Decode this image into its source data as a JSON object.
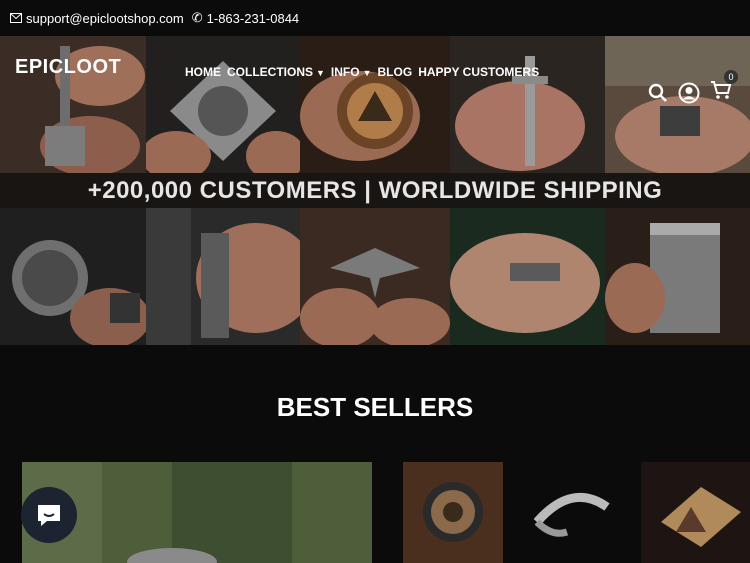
{
  "topbar": {
    "email": "support@epiclootshop.com",
    "phone": "1-863-231-0844"
  },
  "header": {
    "logo": "EPICLOOT",
    "menu": {
      "home": "HOME",
      "collections": "COLLECTIONS",
      "info": "INFO",
      "blog": "BLOG",
      "happy_customers": "HAPPY CUSTOMERS"
    },
    "cart_count": "0"
  },
  "hero": {
    "banner_text": "+200,000 CUSTOMERS | WORLDWIDE SHIPPING"
  },
  "section": {
    "title": "BEST SELLERS"
  }
}
